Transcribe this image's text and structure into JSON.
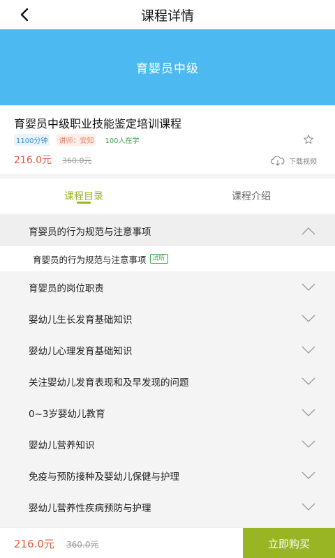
{
  "header": {
    "title": "课程详情",
    "back_icon": "back-arrow-icon"
  },
  "banner": {
    "text": "育婴员中级",
    "color": "#4cbaf0"
  },
  "course": {
    "title": "育婴员中级职业技能鉴定培训课程",
    "duration": "1100分钟",
    "teacher": "讲师：安知",
    "enrolled": "100人在学",
    "price": "216.0元",
    "original_price": "360.0元",
    "download_label": "下载视频"
  },
  "tabs": [
    {
      "label": "课程目录",
      "active": true
    },
    {
      "label": "课程介绍",
      "active": false
    }
  ],
  "chapters": [
    {
      "title": "育婴员的行为规范与注意事项",
      "expanded": true,
      "lessons": [
        {
          "title": "育婴员的行为规范与注意事项",
          "badge": "试听"
        }
      ]
    },
    {
      "title": "育婴员的岗位职责",
      "expanded": false
    },
    {
      "title": "婴幼儿生长发育基础知识",
      "expanded": false
    },
    {
      "title": "婴幼儿心理发育基础知识",
      "expanded": false
    },
    {
      "title": "关注婴幼儿发育表现和及早发现的问题",
      "expanded": false
    },
    {
      "title": "0~3岁婴幼儿教育",
      "expanded": false
    },
    {
      "title": "婴幼儿营养知识",
      "expanded": false
    },
    {
      "title": "免疫与预防接种及婴幼儿保健与护理",
      "expanded": false
    },
    {
      "title": "婴幼儿营养性疾病预防与护理",
      "expanded": false
    }
  ],
  "bottom_bar": {
    "price": "216.0元",
    "original_price": "360.0元",
    "buy_label": "立即购买"
  },
  "colors": {
    "accent": "#9ab523",
    "price": "#e25a3a",
    "banner": "#4cbaf0"
  }
}
